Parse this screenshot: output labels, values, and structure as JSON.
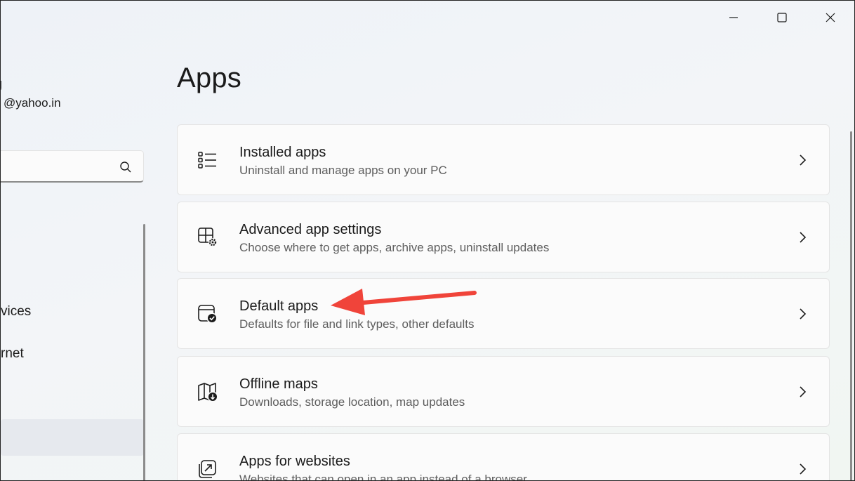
{
  "window": {
    "minimize_icon": "minimize-icon",
    "maximize_icon": "maximize-icon",
    "close_icon": "close-icon"
  },
  "sidebar": {
    "user_name": "g",
    "user_email": "@yahoo.in",
    "search": {
      "value": "",
      "placeholder": ""
    },
    "nav_items": [
      {
        "label": "vices"
      },
      {
        "label": "rnet"
      }
    ]
  },
  "main": {
    "title": "Apps",
    "cards": [
      {
        "title": "Installed apps",
        "subtitle": "Uninstall and manage apps on your PC",
        "icon": "list-icon"
      },
      {
        "title": "Advanced app settings",
        "subtitle": "Choose where to get apps, archive apps, uninstall updates",
        "icon": "app-settings-icon"
      },
      {
        "title": "Default apps",
        "subtitle": "Defaults for file and link types, other defaults",
        "icon": "default-apps-icon"
      },
      {
        "title": "Offline maps",
        "subtitle": "Downloads, storage location, map updates",
        "icon": "offline-maps-icon"
      },
      {
        "title": "Apps for websites",
        "subtitle": "Websites that can open in an app instead of a browser",
        "icon": "apps-for-websites-icon"
      }
    ]
  },
  "colors": {
    "accent_arrow": "#f0443a"
  }
}
